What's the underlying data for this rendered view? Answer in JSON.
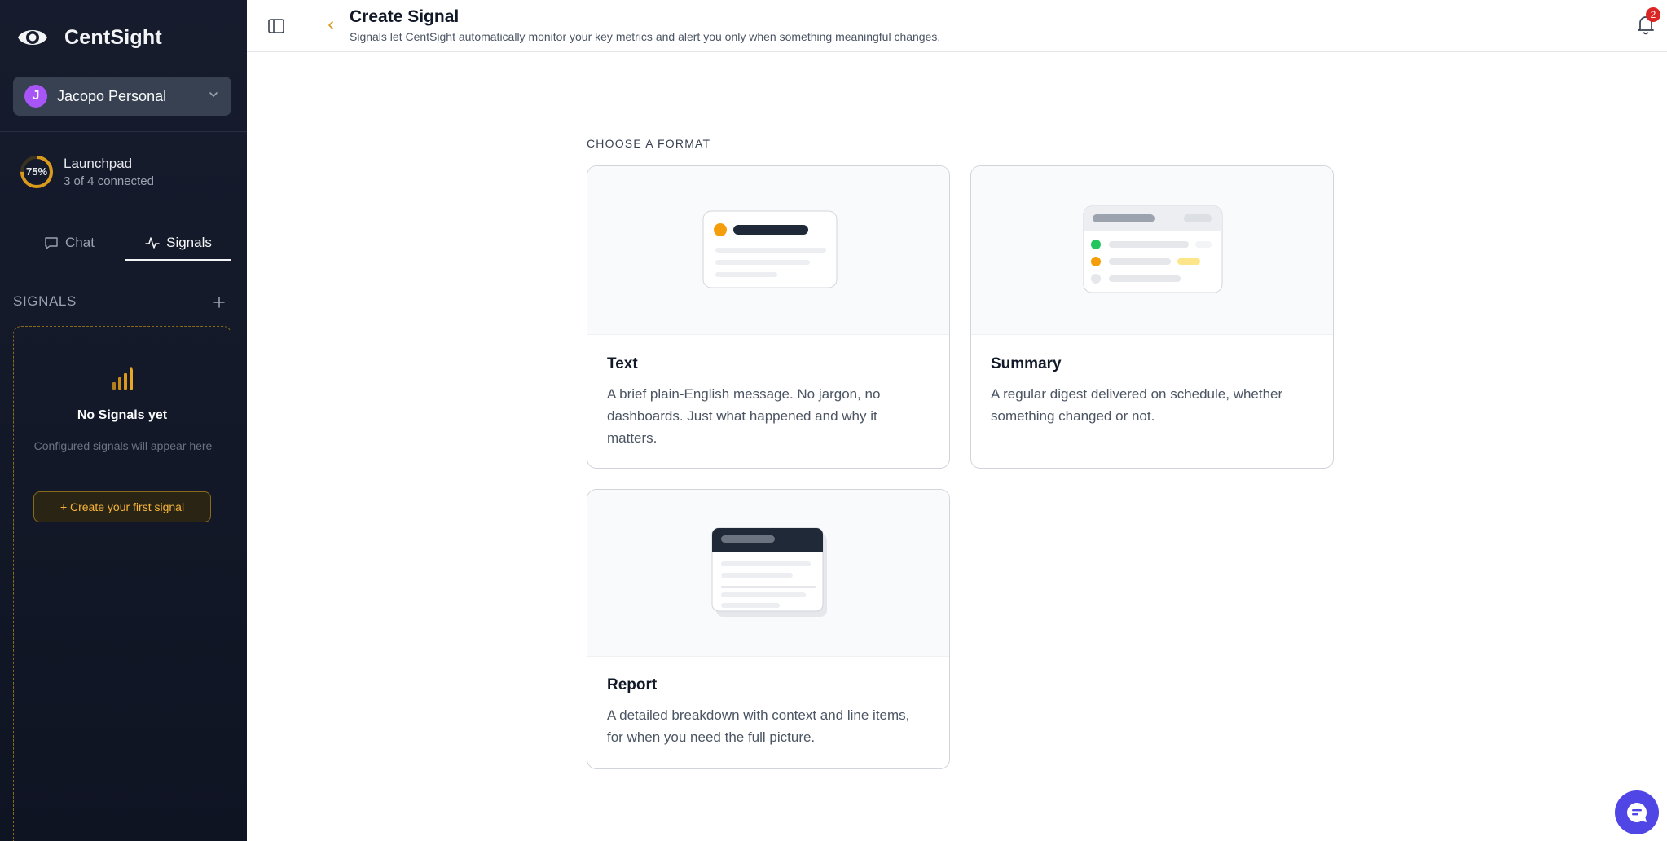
{
  "app": {
    "name": "CentSight"
  },
  "workspace": {
    "initial": "J",
    "name": "Jacopo Personal",
    "avatar_color": "#a855f7"
  },
  "launchpad": {
    "percent": 75,
    "percent_label": "75%",
    "title": "Launchpad",
    "status": "3 of 4 connected"
  },
  "tabs": [
    {
      "label": "Chat",
      "icon": "chat-bubble-icon",
      "active": false
    },
    {
      "label": "Signals",
      "icon": "activity-icon",
      "active": true
    }
  ],
  "signals": {
    "section_label": "SIGNALS",
    "empty_title": "No Signals yet",
    "empty_subtitle": "Configured signals will appear here",
    "create_first_label": "+ Create your first signal"
  },
  "header": {
    "title": "Create Signal",
    "subtitle": "Signals let CentSight automatically monitor your key metrics and alert you only when something meaningful changes.",
    "notification_count": "2"
  },
  "main": {
    "section_label": "CHOOSE A FORMAT",
    "formats": [
      {
        "title": "Text",
        "description": "A brief plain-English message. No jargon, no dashboards. Just what happened and why it matters."
      },
      {
        "title": "Summary",
        "description": "A regular digest delivered on schedule, whether something changed or not."
      },
      {
        "title": "Report",
        "description": "A detailed breakdown with context and line items, for when you need the full picture."
      }
    ]
  },
  "colors": {
    "accent": "#f59e0b",
    "sidebar_bg": "#141a2b",
    "fab": "#4f46e5",
    "badge": "#dc2626"
  }
}
